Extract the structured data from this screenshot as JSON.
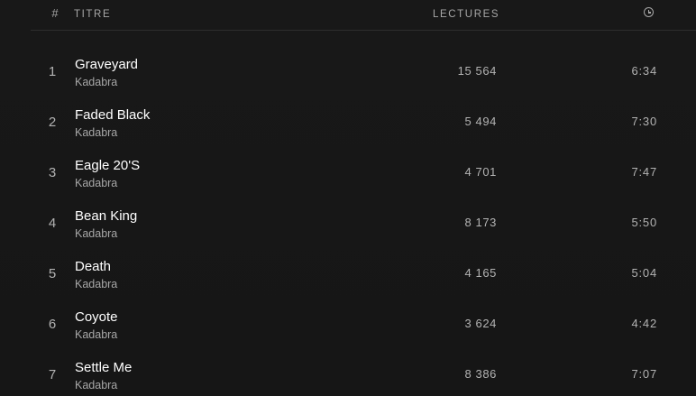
{
  "header": {
    "number_label": "#",
    "title_label": "TITRE",
    "plays_label": "LECTURES",
    "duration_icon": "clock-icon"
  },
  "tracks": [
    {
      "number": "1",
      "title": "Graveyard",
      "artist": "Kadabra",
      "plays": "15 564",
      "duration": "6:34"
    },
    {
      "number": "2",
      "title": "Faded Black",
      "artist": "Kadabra",
      "plays": "5 494",
      "duration": "7:30"
    },
    {
      "number": "3",
      "title": "Eagle 20'S",
      "artist": "Kadabra",
      "plays": "4 701",
      "duration": "7:47"
    },
    {
      "number": "4",
      "title": "Bean King",
      "artist": "Kadabra",
      "plays": "8 173",
      "duration": "5:50"
    },
    {
      "number": "5",
      "title": "Death",
      "artist": "Kadabra",
      "plays": "4 165",
      "duration": "5:04"
    },
    {
      "number": "6",
      "title": "Coyote",
      "artist": "Kadabra",
      "plays": "3 624",
      "duration": "4:42"
    },
    {
      "number": "7",
      "title": "Settle Me",
      "artist": "Kadabra",
      "plays": "8 386",
      "duration": "7:07"
    }
  ],
  "colors": {
    "background": "#171717",
    "primary_text": "#ffffff",
    "secondary_text": "#a7a7a7"
  }
}
